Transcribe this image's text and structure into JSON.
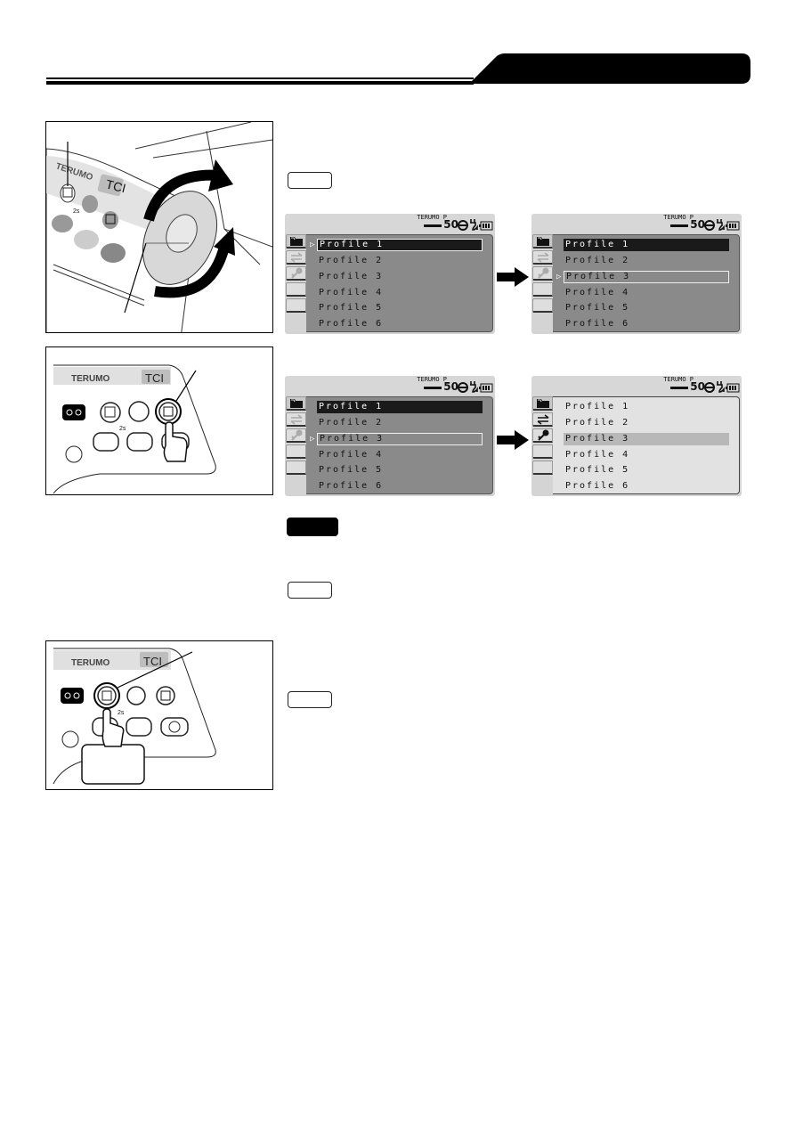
{
  "header": {
    "tab_color": "#000000",
    "rule_color": "#000000"
  },
  "figures": [
    {
      "id": "fig1",
      "description": "Pump side view with rotary dial and rotation arrows",
      "brand": "TERUMO",
      "model_badge": "TCI",
      "menu_key_hint": "2s",
      "icons": [
        "menu-button-icon",
        "back-button-icon",
        "confirm-button-icon",
        "rewind-button-icon",
        "start-button-icon",
        "stop-button-icon",
        "rotary-dial-icon",
        "clockwise-arrow-icon",
        "counterclockwise-arrow-icon"
      ]
    },
    {
      "id": "fig2",
      "description": "Control panel with finger pressing confirm key",
      "brand": "TERUMO",
      "model_badge": "TCI",
      "menu_key_hint": "2s",
      "icons": [
        "power-button-icon",
        "menu-button-icon",
        "back-button-icon",
        "confirm-button-icon",
        "rewind-button-icon",
        "start-button-icon",
        "finger-press-icon"
      ]
    },
    {
      "id": "fig3",
      "description": "Control panel with finger pressing menu key",
      "brand": "TERUMO",
      "model_badge": "TCI",
      "menu_key_hint": "2s",
      "icons": [
        "power-button-icon",
        "menu-button-icon",
        "back-button-icon",
        "confirm-button-icon",
        "rewind-button-icon",
        "start-button-icon",
        "stop-button-icon",
        "finger-press-icon"
      ]
    }
  ],
  "labels": [
    {
      "style": "outline",
      "text": ""
    },
    {
      "style": "dark",
      "text": ""
    },
    {
      "style": "outline",
      "text": ""
    },
    {
      "style": "outline",
      "text": ""
    }
  ],
  "screens": [
    {
      "id": "screen-a",
      "status": {
        "brand": "TERUMO P",
        "volume": "50"
      },
      "tabs": [
        "folder-icon",
        "swap-icon",
        "key-icon",
        "",
        ""
      ],
      "active_tab": 0,
      "profiles": [
        "Profile 1",
        "Profile 2",
        "Profile 3",
        "Profile 4",
        "Profile 5",
        "Profile 6"
      ],
      "highlighted_index": 0,
      "cursor_index": 0,
      "popup": false
    },
    {
      "id": "screen-b",
      "status": {
        "brand": "TERUMO P",
        "volume": "50"
      },
      "tabs": [
        "folder-icon",
        "swap-icon",
        "key-icon",
        "",
        ""
      ],
      "active_tab": 0,
      "profiles": [
        "Profile 1",
        "Profile 2",
        "Profile 3",
        "Profile 4",
        "Profile 5",
        "Profile 6"
      ],
      "highlighted_index": 0,
      "cursor_index": 2,
      "popup": false
    },
    {
      "id": "screen-c",
      "status": {
        "brand": "TERUMO P",
        "volume": "50"
      },
      "tabs": [
        "folder-icon",
        "swap-icon",
        "key-icon",
        "",
        ""
      ],
      "active_tab": 0,
      "profiles": [
        "Profile 1",
        "Profile 2",
        "Profile 3",
        "Profile 4",
        "Profile 5",
        "Profile 6"
      ],
      "highlighted_index": 0,
      "cursor_index": 2,
      "popup": false
    },
    {
      "id": "screen-d",
      "status": {
        "brand": "TERUMO P",
        "volume": "50"
      },
      "tabs": [
        "folder-icon",
        "swap-icon",
        "key-icon",
        "",
        ""
      ],
      "active_tab": 0,
      "profiles": [
        "Profile 1",
        "Profile 2",
        "Profile 3",
        "Profile 4",
        "Profile 5",
        "Profile 6"
      ],
      "highlighted_index": 2,
      "cursor_index": null,
      "popup": true
    }
  ],
  "colors": {
    "lcd_bg": "#d4d4d4",
    "lcd_body": "#8a8a8a",
    "lcd_popup_body": "#e2e2e2",
    "selected_dark": "#1a1a1a",
    "selected_grey": "#b8b8b8",
    "panel_grey": "#c8c8c8"
  }
}
